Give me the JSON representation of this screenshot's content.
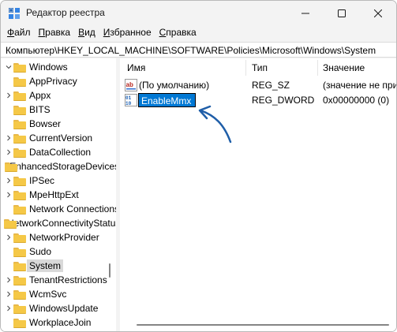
{
  "window": {
    "title": "Редактор реестра",
    "accent": "#0078d4"
  },
  "menu": [
    {
      "first": "Ф",
      "rest": "айл"
    },
    {
      "first": "П",
      "rest": "равка"
    },
    {
      "first": "В",
      "rest": "ид"
    },
    {
      "first": "И",
      "rest": "збранное"
    },
    {
      "first": "С",
      "rest": "правка"
    }
  ],
  "address": "Компьютер\\HKEY_LOCAL_MACHINE\\SOFTWARE\\Policies\\Microsoft\\Windows\\System",
  "tree": {
    "root": "Windows",
    "items": [
      {
        "label": "AppPrivacy",
        "expandable": false
      },
      {
        "label": "Appx",
        "expandable": true
      },
      {
        "label": "BITS",
        "expandable": false
      },
      {
        "label": "Bowser",
        "expandable": false
      },
      {
        "label": "CurrentVersion",
        "expandable": true
      },
      {
        "label": "DataCollection",
        "expandable": true
      },
      {
        "label": "EnhancedStorageDevices",
        "expandable": false
      },
      {
        "label": "IPSec",
        "expandable": true
      },
      {
        "label": "MpeHttpExt",
        "expandable": true
      },
      {
        "label": "Network Connections",
        "expandable": false
      },
      {
        "label": "NetworkConnectivityStatusIndicator",
        "expandable": false
      },
      {
        "label": "NetworkProvider",
        "expandable": true
      },
      {
        "label": "Sudo",
        "expandable": false
      },
      {
        "label": "System",
        "expandable": false,
        "selected": true
      },
      {
        "label": "TenantRestrictions",
        "expandable": true
      },
      {
        "label": "WcmSvc",
        "expandable": true
      },
      {
        "label": "WindowsUpdate",
        "expandable": true
      },
      {
        "label": "WorkplaceJoin",
        "expandable": false
      }
    ]
  },
  "columns": {
    "name": "Имя",
    "type": "Тип",
    "value": "Значение"
  },
  "values": [
    {
      "icon": "string-value-icon",
      "name": "(По умолчанию)",
      "type": "REG_SZ",
      "data": "(значение не присвоено)"
    },
    {
      "icon": "binary-value-icon",
      "name": "EnableMmx",
      "type": "REG_DWORD",
      "data": "0x00000000 (0)",
      "editing": true
    }
  ]
}
